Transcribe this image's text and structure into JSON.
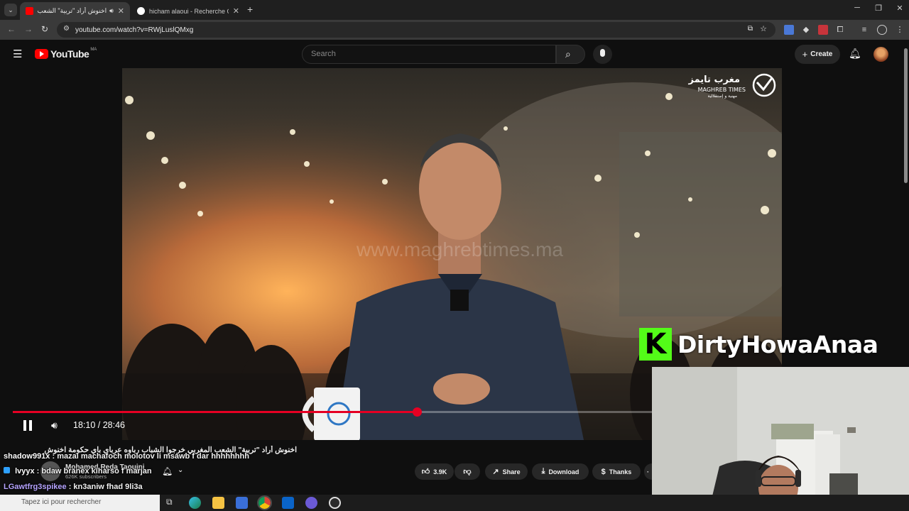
{
  "browser": {
    "tabs": [
      {
        "title": "اخنوش أراد \"تربية\" الشعب ال..."
      },
      {
        "title": "hicham alaoui - Recherche Goo..."
      }
    ],
    "url": "youtube.com/watch?v=RWjLuslQMxg"
  },
  "youtube": {
    "logo_text": "YouTube",
    "region": "MA",
    "search_placeholder": "Search",
    "create_label": "Create"
  },
  "video": {
    "watermark": "www.maghrebtimes.ma",
    "channel_logo_line1": "مغرب تايمز",
    "channel_logo_line2": "MAGHREB TIMES",
    "channel_logo_line3": "مهنية و إستقلالية",
    "current_time": "18:10",
    "duration": "28:46",
    "progress": 0.6321,
    "title": "اخنوش أراد \"تربية\" الشعب المغربي خرجوا الشباب رباوه عرباي باي حكومة اخنوش"
  },
  "channel": {
    "name": "Mohamed Reda Taoujni",
    "subscribers": "626K subscribers"
  },
  "actions": {
    "likes": "3.9K",
    "share": "Share",
    "download": "Download",
    "thanks": "Thanks"
  },
  "stream_overlay": {
    "kick_letter": "K",
    "streamer": "DirtyHowaAnaa",
    "chat": [
      {
        "user": "shadow991x",
        "message": ": mazal machafoch molotov li msawb f dar hhhhhhhh",
        "user_color": "#ffffff"
      },
      {
        "user": "lvyyx",
        "message": ": bdaw branex kiharso f marjan",
        "user_color": "#ffffff"
      },
      {
        "user": "LGawtfrg3spikee",
        "message": ": kn3aniw fhad 9li3a",
        "user_color": "#b6a4ff"
      }
    ]
  },
  "taskbar": {
    "search_text": "Tapez ici pour rechercher"
  },
  "colors": {
    "youtube_red": "#ff0000",
    "progress_red": "#e60023",
    "kick_green": "#53fc18"
  }
}
